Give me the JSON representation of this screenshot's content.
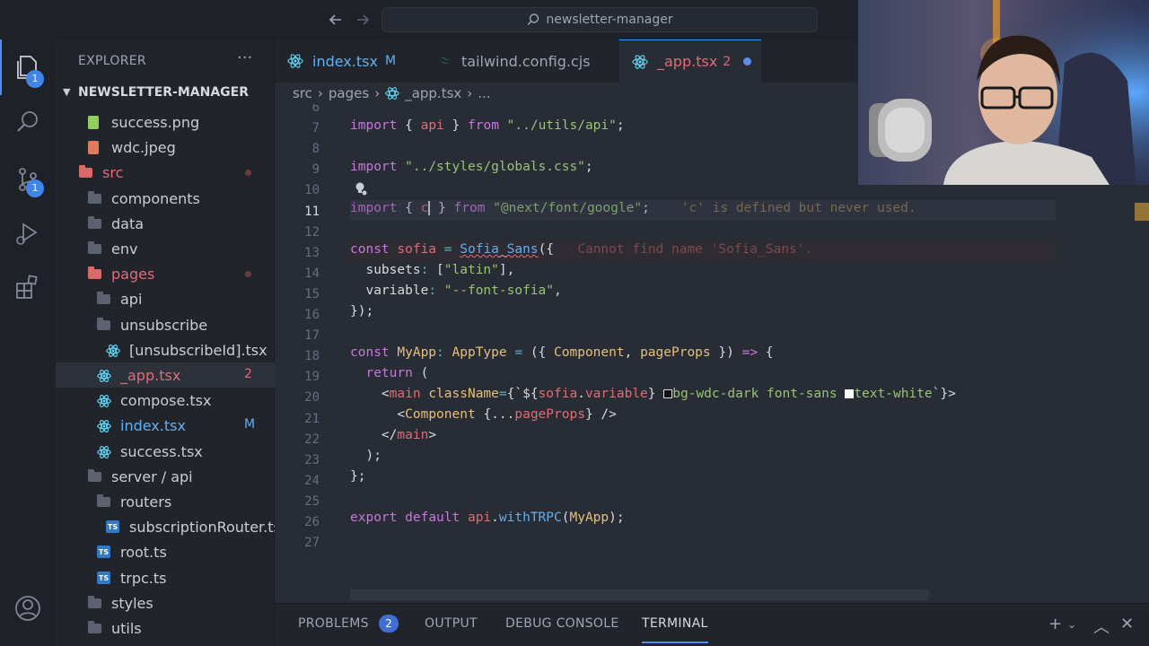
{
  "titlebar": {
    "search_label": "newsletter-manager"
  },
  "activity": {
    "explorer_badge": "1",
    "scm_badge": "1"
  },
  "explorer": {
    "title": "EXPLORER",
    "root": "NEWSLETTER-MANAGER",
    "items": [
      {
        "label": "success.png",
        "indent": 1,
        "kind": "png"
      },
      {
        "label": "wdc.jpeg",
        "indent": 1,
        "kind": "jpeg"
      },
      {
        "label": "src",
        "indent": 0,
        "kind": "folder-red",
        "modified": true
      },
      {
        "label": "components",
        "indent": 1,
        "kind": "folder"
      },
      {
        "label": "data",
        "indent": 1,
        "kind": "folder"
      },
      {
        "label": "env",
        "indent": 1,
        "kind": "folder"
      },
      {
        "label": "pages",
        "indent": 1,
        "kind": "folder-red",
        "modified": true
      },
      {
        "label": "api",
        "indent": 2,
        "kind": "folder"
      },
      {
        "label": "unsubscribe",
        "indent": 2,
        "kind": "folder"
      },
      {
        "label": "[unsubscribeId].tsx",
        "indent": 3,
        "kind": "react"
      },
      {
        "label": "_app.tsx",
        "indent": 2,
        "kind": "react",
        "deco": "2",
        "selected": true,
        "error": true
      },
      {
        "label": "compose.tsx",
        "indent": 2,
        "kind": "react"
      },
      {
        "label": "index.tsx",
        "indent": 2,
        "kind": "react",
        "deco": "M",
        "modifiedBlue": true
      },
      {
        "label": "success.tsx",
        "indent": 2,
        "kind": "react"
      },
      {
        "label": "server / api",
        "indent": 1,
        "kind": "folder"
      },
      {
        "label": "routers",
        "indent": 2,
        "kind": "folder"
      },
      {
        "label": "subscriptionRouter.ts",
        "indent": 3,
        "kind": "ts"
      },
      {
        "label": "root.ts",
        "indent": 2,
        "kind": "ts"
      },
      {
        "label": "trpc.ts",
        "indent": 2,
        "kind": "ts"
      },
      {
        "label": "styles",
        "indent": 1,
        "kind": "folder"
      },
      {
        "label": "utils",
        "indent": 1,
        "kind": "folder"
      }
    ]
  },
  "tabs": [
    {
      "label": "index.tsx",
      "deco": "M"
    },
    {
      "label": "tailwind.config.cjs",
      "deco": ""
    },
    {
      "label": "_app.tsx",
      "deco": "2"
    }
  ],
  "breadcrumb": [
    "src",
    "pages",
    "_app.tsx",
    "..."
  ],
  "editor": {
    "line_numbers": [
      "6",
      "7",
      "8",
      "9",
      "10",
      "11",
      "12",
      "13",
      "14",
      "15",
      "16",
      "17",
      "18",
      "19",
      "20",
      "21",
      "22",
      "23",
      "24",
      "25",
      "26",
      "27"
    ],
    "hint_line11": "'c' is defined but never used.",
    "hint_line13": "Cannot find name 'Sofia_Sans'."
  },
  "panel": {
    "problems": "PROBLEMS",
    "problems_count": "2",
    "output": "OUTPUT",
    "debug": "DEBUG CONSOLE",
    "terminal": "TERMINAL"
  }
}
